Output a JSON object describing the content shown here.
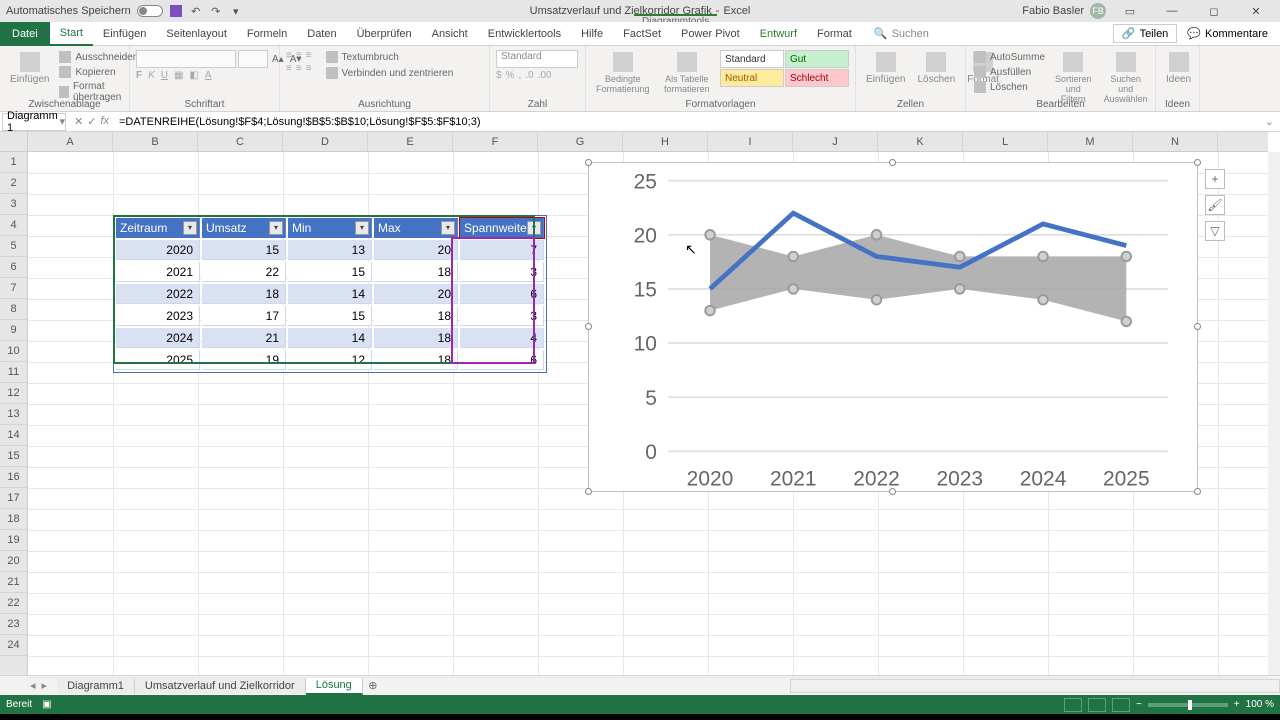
{
  "titlebar": {
    "autosave_label": "Automatisches Speichern",
    "doc_title": "Umsatzverlauf und Zielkorridor Grafik",
    "app_name": "Excel",
    "contextual_tool_label": "Diagrammtools",
    "user_name": "Fabio Basler",
    "user_initials": "FB"
  },
  "ribbon_tabs": {
    "file": "Datei",
    "start": "Start",
    "einfuegen": "Einfügen",
    "seitenlayout": "Seitenlayout",
    "formeln": "Formeln",
    "daten": "Daten",
    "ueberpruefen": "Überprüfen",
    "ansicht": "Ansicht",
    "entwicklertools": "Entwicklertools",
    "hilfe": "Hilfe",
    "factset": "FactSet",
    "powerpivot": "Power Pivot",
    "entwurf": "Entwurf",
    "format": "Format",
    "search_placeholder": "Suchen",
    "share": "Teilen",
    "comments": "Kommentare"
  },
  "ribbon": {
    "clipboard": {
      "label": "Zwischenablage",
      "paste": "Einfügen",
      "cut": "Ausschneiden",
      "copy": "Kopieren",
      "format_painter": "Format übertragen"
    },
    "font": {
      "label": "Schriftart"
    },
    "alignment": {
      "label": "Ausrichtung",
      "wrap": "Textumbruch",
      "merge": "Verbinden und zentrieren"
    },
    "number": {
      "label": "Zahl",
      "format": "Standard"
    },
    "styles": {
      "label": "Formatvorlagen",
      "cond": "Bedingte Formatierung",
      "astable": "Als Tabelle formatieren",
      "standard": "Standard",
      "gut": "Gut",
      "neutral": "Neutral",
      "schlecht": "Schlecht"
    },
    "cells": {
      "label": "Zellen",
      "insert": "Einfügen",
      "delete": "Löschen",
      "format": "Format"
    },
    "editing": {
      "label": "Bearbeiten",
      "autosum": "AutoSumme",
      "fill": "Ausfüllen",
      "clear": "Löschen",
      "sort": "Sortieren und Filtern",
      "find": "Suchen und Auswählen"
    },
    "ideas": {
      "label": "Ideen",
      "btn": "Ideen"
    }
  },
  "formula_bar": {
    "name_box": "Diagramm 1",
    "formula": "=DATENREIHE(Lösung!$F$4;Lösung!$B$5:$B$10;Lösung!$F$5:$F$10;3)"
  },
  "columns": [
    "A",
    "B",
    "C",
    "D",
    "E",
    "F",
    "G",
    "H",
    "I",
    "J",
    "K",
    "L",
    "M",
    "N"
  ],
  "table": {
    "headers": {
      "zeitraum": "Zeitraum",
      "umsatz": "Umsatz",
      "min": "Min",
      "max": "Max",
      "spannweite": "Spannweite"
    },
    "rows": [
      {
        "zeitraum": "2020",
        "umsatz": "15",
        "min": "13",
        "max": "20",
        "spannweite": "7"
      },
      {
        "zeitraum": "2021",
        "umsatz": "22",
        "min": "15",
        "max": "18",
        "spannweite": "3"
      },
      {
        "zeitraum": "2022",
        "umsatz": "18",
        "min": "14",
        "max": "20",
        "spannweite": "6"
      },
      {
        "zeitraum": "2023",
        "umsatz": "17",
        "min": "15",
        "max": "18",
        "spannweite": "3"
      },
      {
        "zeitraum": "2024",
        "umsatz": "21",
        "min": "14",
        "max": "18",
        "spannweite": "4"
      },
      {
        "zeitraum": "2025",
        "umsatz": "19",
        "min": "12",
        "max": "18",
        "spannweite": "6"
      }
    ]
  },
  "chart_data": {
    "type": "line",
    "categories": [
      "2020",
      "2021",
      "2022",
      "2023",
      "2024",
      "2025"
    ],
    "series": [
      {
        "name": "Umsatz",
        "values": [
          15,
          22,
          18,
          17,
          21,
          19
        ],
        "style": "line"
      },
      {
        "name": "Min",
        "values": [
          13,
          15,
          14,
          15,
          14,
          12
        ],
        "style": "area-low"
      },
      {
        "name": "Max",
        "values": [
          20,
          18,
          20,
          18,
          18,
          18
        ],
        "style": "area-high"
      }
    ],
    "ylim": [
      0,
      25
    ],
    "yticks": [
      0,
      5,
      10,
      15,
      20,
      25
    ],
    "gridlines": "horizontal"
  },
  "sheet_tabs": {
    "t1": "Diagramm1",
    "t2": "Umsatzverlauf und Zielkorridor",
    "t3": "Lösung"
  },
  "statusbar": {
    "ready": "Bereit",
    "zoom": "100 %"
  }
}
